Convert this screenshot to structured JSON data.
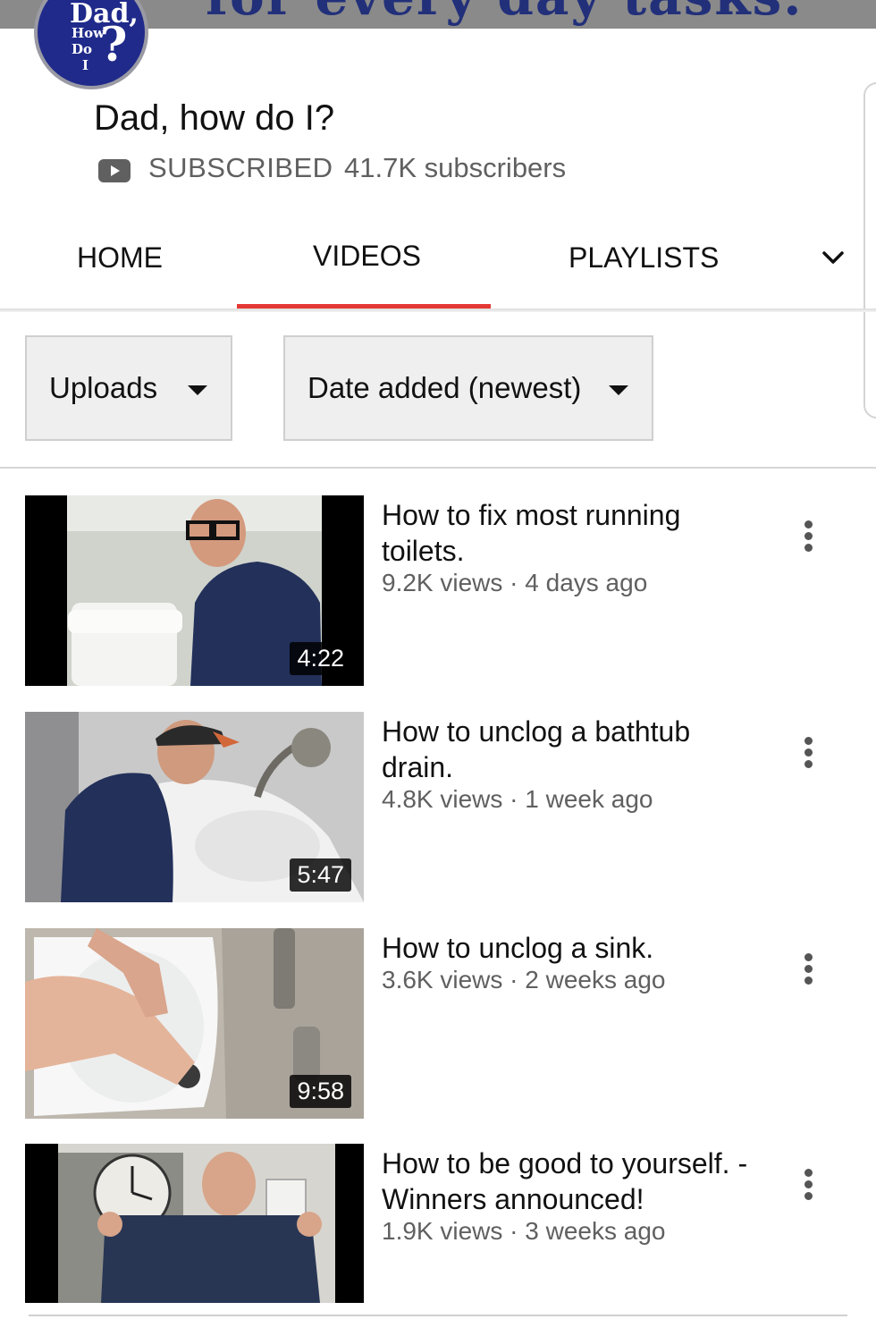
{
  "banner": {
    "text": "for every day tasks."
  },
  "avatar": {
    "line1": "Dad,",
    "line2": "How",
    "line3": "Do",
    "line4": "I",
    "mark": "?"
  },
  "channel": {
    "name": "Dad, how do I?",
    "subscribed_label": "SUBSCRIBED",
    "subscriber_count": "41.7K subscribers"
  },
  "tabs": [
    {
      "label": "HOME"
    },
    {
      "label": "VIDEOS",
      "active": true
    },
    {
      "label": "PLAYLISTS"
    }
  ],
  "filters": {
    "type_value": "Uploads",
    "sort_value": "Date added (newest)"
  },
  "videos": [
    {
      "title": "How to fix most running toilets.",
      "views": "9.2K views",
      "age": "4 days ago",
      "meta": "9.2K views · 4 days ago",
      "duration": "4:22"
    },
    {
      "title": "How to unclog a bathtub drain.",
      "views": "4.8K views",
      "age": "1 week ago",
      "meta": "4.8K views · 1 week ago",
      "duration": "5:47"
    },
    {
      "title": "How to unclog a sink.",
      "views": "3.6K views",
      "age": "2 weeks ago",
      "meta": "3.6K views · 2 weeks ago",
      "duration": "9:58"
    },
    {
      "title": "How to be good to yourself. - Winners announced!",
      "views": "1.9K views",
      "age": "3 weeks ago",
      "meta": "1.9K views · 3 weeks ago",
      "duration": ""
    }
  ],
  "colors": {
    "accent": "#e53935",
    "banner_text": "#22307a",
    "avatar_bg": "#1f2a8a",
    "meta_text": "#606060"
  },
  "icons": {
    "subscribe": "youtube-play-icon",
    "more": "more-vert-icon",
    "caret": "caret-down-icon",
    "chevron": "chevron-down-icon"
  }
}
